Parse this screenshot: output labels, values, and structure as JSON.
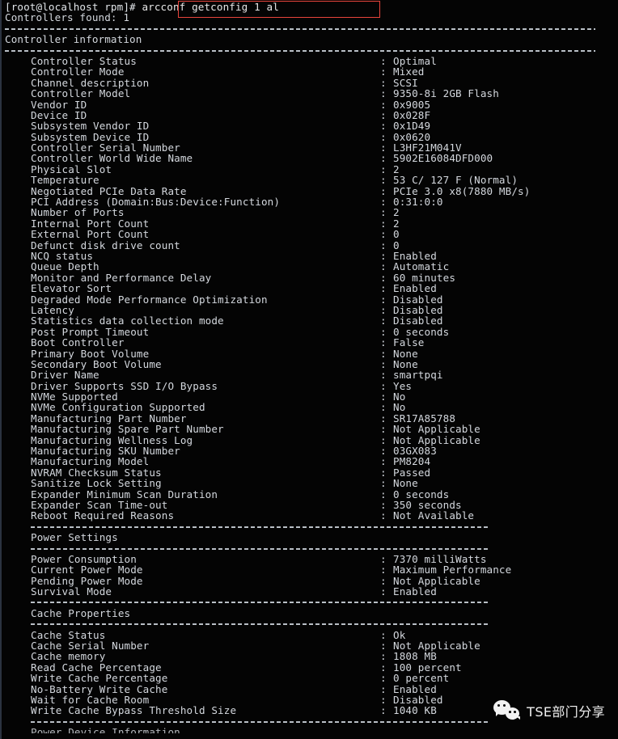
{
  "terminal": {
    "prompt": "[root@localhost rpm]# ",
    "command": "arcconf getconfig 1 al",
    "command_highlight_color": "#e8453c",
    "controllers_found_line": "Controllers found: 1",
    "sections": [
      {
        "title": "Controller information",
        "rows": [
          {
            "key": "Controller Status",
            "value": "Optimal"
          },
          {
            "key": "Controller Mode",
            "value": "Mixed"
          },
          {
            "key": "Channel description",
            "value": "SCSI"
          },
          {
            "key": "Controller Model",
            "value": "9350-8i 2GB Flash"
          },
          {
            "key": "Vendor ID",
            "value": "0x9005"
          },
          {
            "key": "Device ID",
            "value": "0x028F"
          },
          {
            "key": "Subsystem Vendor ID",
            "value": "0x1D49"
          },
          {
            "key": "Subsystem Device ID",
            "value": "0x0620"
          },
          {
            "key": "Controller Serial Number",
            "value": "L3HF21M041V"
          },
          {
            "key": "Controller World Wide Name",
            "value": "5902E16084DFD000"
          },
          {
            "key": "Physical Slot",
            "value": "2"
          },
          {
            "key": "Temperature",
            "value": "53 C/ 127 F (Normal)"
          },
          {
            "key": "Negotiated PCIe Data Rate",
            "value": "PCIe 3.0 x8(7880 MB/s)"
          },
          {
            "key": "PCI Address (Domain:Bus:Device:Function)",
            "value": "0:31:0:0"
          },
          {
            "key": "Number of Ports",
            "value": "2"
          },
          {
            "key": "Internal Port Count",
            "value": "2"
          },
          {
            "key": "External Port Count",
            "value": "0"
          },
          {
            "key": "Defunct disk drive count",
            "value": "0"
          },
          {
            "key": "NCQ status",
            "value": "Enabled"
          },
          {
            "key": "Queue Depth",
            "value": "Automatic"
          },
          {
            "key": "Monitor and Performance Delay",
            "value": "60 minutes"
          },
          {
            "key": "Elevator Sort",
            "value": "Enabled"
          },
          {
            "key": "Degraded Mode Performance Optimization",
            "value": "Disabled"
          },
          {
            "key": "Latency",
            "value": "Disabled"
          },
          {
            "key": "Statistics data collection mode",
            "value": "Disabled"
          },
          {
            "key": "Post Prompt Timeout",
            "value": "0 seconds"
          },
          {
            "key": "Boot Controller",
            "value": "False"
          },
          {
            "key": "Primary Boot Volume",
            "value": "None"
          },
          {
            "key": "Secondary Boot Volume",
            "value": "None"
          },
          {
            "key": "Driver Name",
            "value": "smartpqi"
          },
          {
            "key": "Driver Supports SSD I/O Bypass",
            "value": "Yes"
          },
          {
            "key": "NVMe Supported",
            "value": "No"
          },
          {
            "key": "NVMe Configuration Supported",
            "value": "No"
          },
          {
            "key": "Manufacturing Part Number",
            "value": "SR17A85788"
          },
          {
            "key": "Manufacturing Spare Part Number",
            "value": "Not Applicable"
          },
          {
            "key": "Manufacturing Wellness Log",
            "value": "Not Applicable"
          },
          {
            "key": "Manufacturing SKU Number",
            "value": "03GX083"
          },
          {
            "key": "Manufacturing Model",
            "value": "PM8204"
          },
          {
            "key": "NVRAM Checksum Status",
            "value": "Passed"
          },
          {
            "key": "Sanitize Lock Setting",
            "value": "None"
          },
          {
            "key": "Expander Minimum Scan Duration",
            "value": "0 seconds"
          },
          {
            "key": "Expander Scan Time-out",
            "value": "350 seconds"
          },
          {
            "key": "Reboot Required Reasons",
            "value": "Not Available"
          }
        ]
      },
      {
        "title": "Power Settings",
        "rows": [
          {
            "key": "Power Consumption",
            "value": "7370 milliWatts"
          },
          {
            "key": "Current Power Mode",
            "value": "Maximum Performance"
          },
          {
            "key": "Pending Power Mode",
            "value": "Not Applicable"
          },
          {
            "key": "Survival Mode",
            "value": "Enabled"
          }
        ]
      },
      {
        "title": "Cache Properties",
        "rows": [
          {
            "key": "Cache Status",
            "value": "Ok"
          },
          {
            "key": "Cache Serial Number",
            "value": "Not Applicable"
          },
          {
            "key": "Cache memory",
            "value": "1808 MB"
          },
          {
            "key": "Read Cache Percentage",
            "value": "100 percent"
          },
          {
            "key": "Write Cache Percentage",
            "value": "0 percent"
          },
          {
            "key": "No-Battery Write Cache",
            "value": "Enabled"
          },
          {
            "key": "Wait for Cache Room",
            "value": "Disabled"
          },
          {
            "key": "Write Cache Bypass Threshold Size",
            "value": "1040 KB"
          }
        ]
      }
    ],
    "truncated_section_title": "Power Device Information"
  },
  "watermark": {
    "icon": "wechat-icon",
    "text": "TSE部门分享"
  }
}
